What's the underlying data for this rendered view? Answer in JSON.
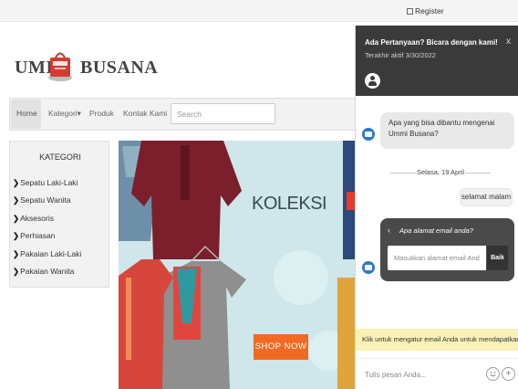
{
  "topbar": {
    "register_label": "Register"
  },
  "header": {
    "logo_left": "UMI",
    "logo_right": "BUSANA"
  },
  "nav": {
    "items": [
      {
        "label": "Home"
      },
      {
        "label": "Kategori▾"
      },
      {
        "label": "Produk"
      },
      {
        "label": "Kontak Kami"
      }
    ],
    "search_placeholder": "Search"
  },
  "sidebar": {
    "title": "KATEGORI",
    "items": [
      {
        "label": "Sepatu Laki-Laki"
      },
      {
        "label": "Sepatu Wanita"
      },
      {
        "label": "Aksesoris"
      },
      {
        "label": "Perhiasan"
      },
      {
        "label": "Pakaian Laki-Laki"
      },
      {
        "label": "Pakaian Wanita"
      }
    ]
  },
  "banner": {
    "heading": "KOLEKSI",
    "cta": "SHOP NOW"
  },
  "chat": {
    "title": "Ada Pertanyaan? Bicara dengan kami!",
    "last_active": "Terakhir aktif 3/30/2022",
    "close": "x",
    "bot_message": "Apa yang bisa dibantu mengenai Ummi Busana?",
    "date_divider": "Selasa, 19 April",
    "user_message": "selamat malam",
    "email_prompt": {
      "back": "‹",
      "question": "Apa alamat email anda?",
      "placeholder": "Masukkan alamat email Anda",
      "button": "Baik"
    },
    "notice": "Klik untuk mengatur email Anda untuk mendapatkan p",
    "composer_placeholder": "Tulis pesan Anda...",
    "emoji_icon": "emoji-icon",
    "plus_icon": "plus-icon"
  },
  "colors": {
    "chat_header": "#3a3a3a",
    "bot_icon": "#2f77d0",
    "shop_now": "#f26a21",
    "notice_bg": "#fbf2b8"
  }
}
